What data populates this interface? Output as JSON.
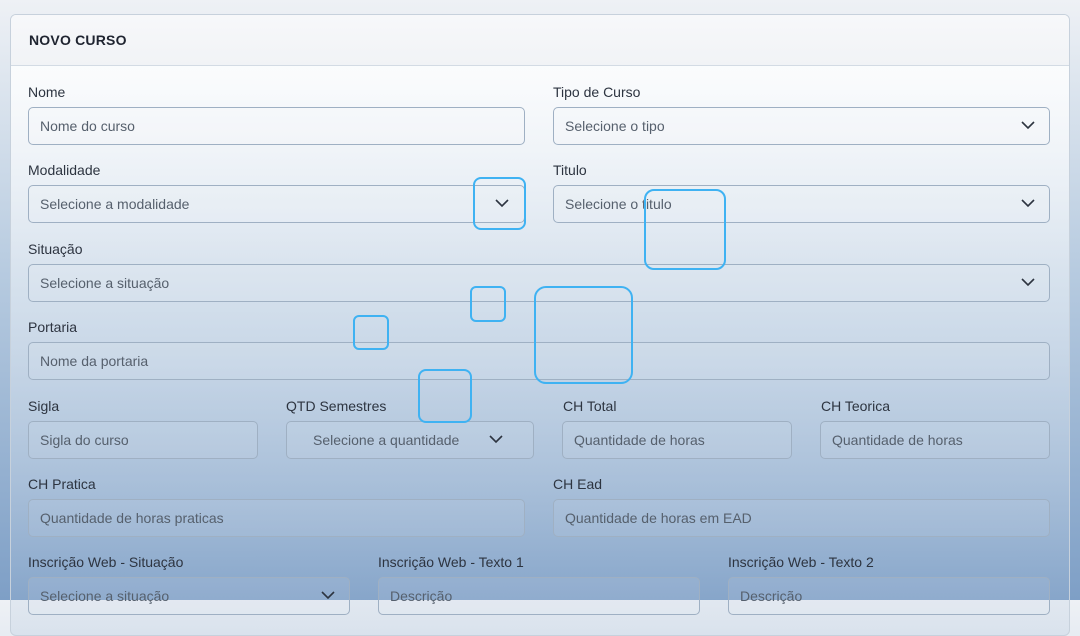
{
  "form": {
    "title": "NOVO CURSO",
    "nome": {
      "label": "Nome",
      "placeholder": "Nome do curso"
    },
    "tipo": {
      "label": "Tipo de Curso",
      "value": "Selecione o tipo"
    },
    "modalidade": {
      "label": "Modalidade",
      "value": "Selecione a modalidade"
    },
    "titulo": {
      "label": "Titulo",
      "value": "Selecione o titulo"
    },
    "situacao": {
      "label": "Situação",
      "value": "Selecione a situação"
    },
    "portaria": {
      "label": "Portaria",
      "placeholder": "Nome da portaria"
    },
    "sigla": {
      "label": "Sigla",
      "placeholder": "Sigla do curso"
    },
    "qtd_semestres": {
      "label": "QTD Semestres",
      "value": "Selecione a quantidade"
    },
    "ch_total": {
      "label": "CH Total",
      "placeholder": "Quantidade de horas"
    },
    "ch_teorica": {
      "label": "CH Teorica",
      "placeholder": "Quantidade de horas"
    },
    "ch_pratica": {
      "label": "CH Pratica",
      "placeholder": "Quantidade de horas praticas"
    },
    "ch_ead": {
      "label": "CH Ead",
      "placeholder": "Quantidade de horas em EAD"
    },
    "web_situacao": {
      "label": "Inscrição Web - Situação",
      "value": "Selecione a situação"
    },
    "web_texto1": {
      "label": "Inscrição Web - Texto 1",
      "placeholder": "Descrição"
    },
    "web_texto2": {
      "label": "Inscrição Web - Texto 2",
      "placeholder": "Descrição"
    }
  },
  "icons": {
    "select_arrow": "chevron-down-icon"
  },
  "colors": {
    "highlight": "#3fb2f2",
    "border": "#9fb0c3"
  }
}
